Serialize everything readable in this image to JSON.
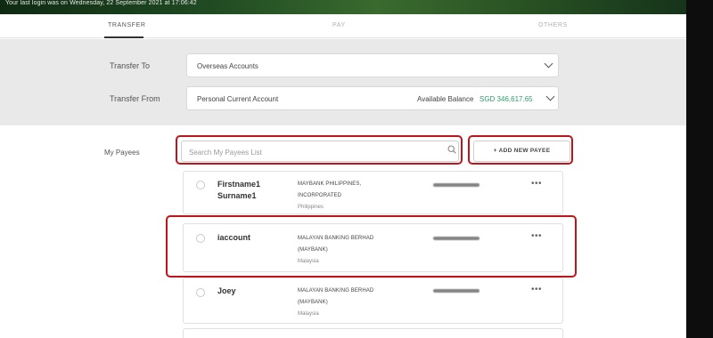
{
  "banner": {
    "text": "Your last login was on Wednesday, 22 September 2021 at 17:06:42"
  },
  "tabs": [
    {
      "label": "TRANSFER",
      "active": true
    },
    {
      "label": "PAY",
      "active": false
    },
    {
      "label": "OTHERS",
      "active": false
    }
  ],
  "form": {
    "transfer_to": {
      "label": "Transfer To",
      "value": "Overseas Accounts"
    },
    "transfer_from": {
      "label": "Transfer From",
      "value": "Personal Current Account",
      "balance_label": "Available Balance",
      "balance_value": "SGD 346,617.65"
    }
  },
  "payees": {
    "label": "My Payees",
    "search_placeholder": "Search My Payees List",
    "add_button": "+ ADD NEW PAYEE",
    "items": [
      {
        "name_line1": "Firstname1",
        "name_line2": "Surname1",
        "bank_line1": "MAYBANK PHILIPPINES,",
        "bank_line2": "INCORPORATED",
        "country": "Philippines"
      },
      {
        "name_line1": "iaccount",
        "name_line2": "",
        "bank_line1": "MALAYAN BANKING BERHAD",
        "bank_line2": "(MAYBANK)",
        "country": "Malaysia"
      },
      {
        "name_line1": "Joey",
        "name_line2": "",
        "bank_line1": "MALAYAN BANKING BERHAD",
        "bank_line2": "(MAYBANK)",
        "country": "Malaysia"
      }
    ],
    "menu_icon": "more-dots-icon"
  },
  "colors": {
    "highlight": "#c0141b",
    "balance": "#2e9d6b",
    "panel_bg": "#e9e9e9"
  }
}
